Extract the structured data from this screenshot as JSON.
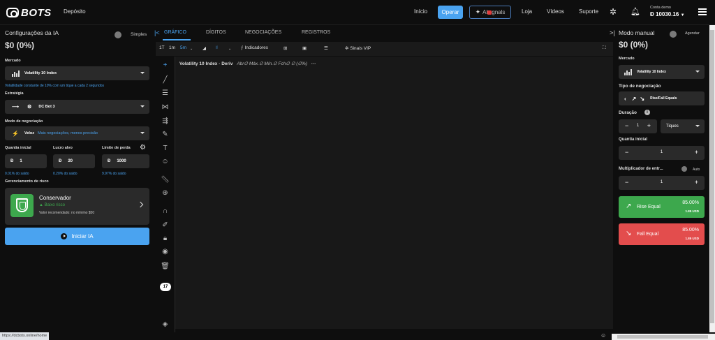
{
  "header": {
    "logo_text": "BOTS",
    "deposit_label": "Depósito",
    "nav": [
      "Início",
      "Operar",
      "AI Signals",
      "Loja",
      "Vídeos",
      "Suporte"
    ],
    "operar_active": "Operar",
    "ai_label": "Al",
    "ai_label_rest": "gnals",
    "demo_account_label": "Conta demo",
    "demo_balance": "Đ  10030.16",
    "icons": [
      "settings-flower-icon",
      "notification-bell-icon",
      "hamburger-menu-icon"
    ]
  },
  "left_panel": {
    "title": "Configurações da IA",
    "mode_label": "Simples",
    "amount": "$0 (0%)",
    "market_label": "Mercado",
    "market_value": "Volatility 10 Index",
    "market_note": "Volatilidade constante de 10% com um tique a cada 2 segundos",
    "strategy_label": "Estratégia",
    "strategy_value": "DC Bot 3",
    "trade_mode_label": "Modo de negociação",
    "trade_mode_value": "Veloz",
    "trade_mode_note": "Mais negociações, menos precisão",
    "initial_qty_label": "Quantia inicial",
    "profit_target_label": "Lucro alvo",
    "loss_limit_label": "Limite de perda",
    "initial_qty_value": "1",
    "profit_target_value": "20",
    "loss_limit_value": "1000",
    "currency_symbol": "Đ",
    "initial_qty_pct": "0.01% do saldo",
    "profit_target_pct": "0.20% do saldo",
    "loss_limit_pct": "9.97% do saldo",
    "risk_label": "Gerenciamento de risco",
    "risk_name": "Conservador",
    "risk_level": "Baixo risco",
    "risk_recommend": "Valor recomendado: no mínimo $50",
    "start_button": "Iniciar IA"
  },
  "center": {
    "tabs": [
      "GRÁFICO",
      "DÍGITOS",
      "NEGOCIAÇÕES",
      "REGISTROS"
    ],
    "toolbar": {
      "tick": "1T",
      "m1": "1m",
      "m5": "5m",
      "indicators": "Indicadores",
      "vip": "Sinais VIP"
    },
    "legend_title": "Volatility 10 Index · Deriv",
    "legend_fields": "Abr∅ Máx.∅ Mín.∅ Fch∅ ∅ (∅%)",
    "legend_more": "···",
    "tv_logo": "17"
  },
  "right_panel": {
    "title": "Modo manual",
    "schedule_label": "Agendar",
    "amount": "$0 (0%)",
    "market_label": "Mercado",
    "market_value": "Volatility 10 Index",
    "trade_type_label": "Tipo de negociação",
    "trade_type_value": "Rise/Fall Equals",
    "duration_label": "Duração",
    "duration_value": "1",
    "duration_unit": "Tiques",
    "initial_qty_label": "Quantia inicial",
    "initial_qty_value": "1",
    "multiplier_label": "Multiplicador de entr...",
    "multiplier_auto": "Auto",
    "multiplier_value": "1",
    "rise_label": "Rise Equal",
    "rise_pct": "85.00%",
    "rise_usd": "1.85 USD",
    "fall_label": "Fall Equal",
    "fall_pct": "85.00%",
    "fall_usd": "1.85 USD"
  },
  "status_url": "https://dcbots.online/home",
  "colors": {
    "accent": "#4aa3f0",
    "rise": "#3da84d",
    "fall": "#e34d4d",
    "panel": "#2a2a2a",
    "background": "#0e0e0e"
  }
}
